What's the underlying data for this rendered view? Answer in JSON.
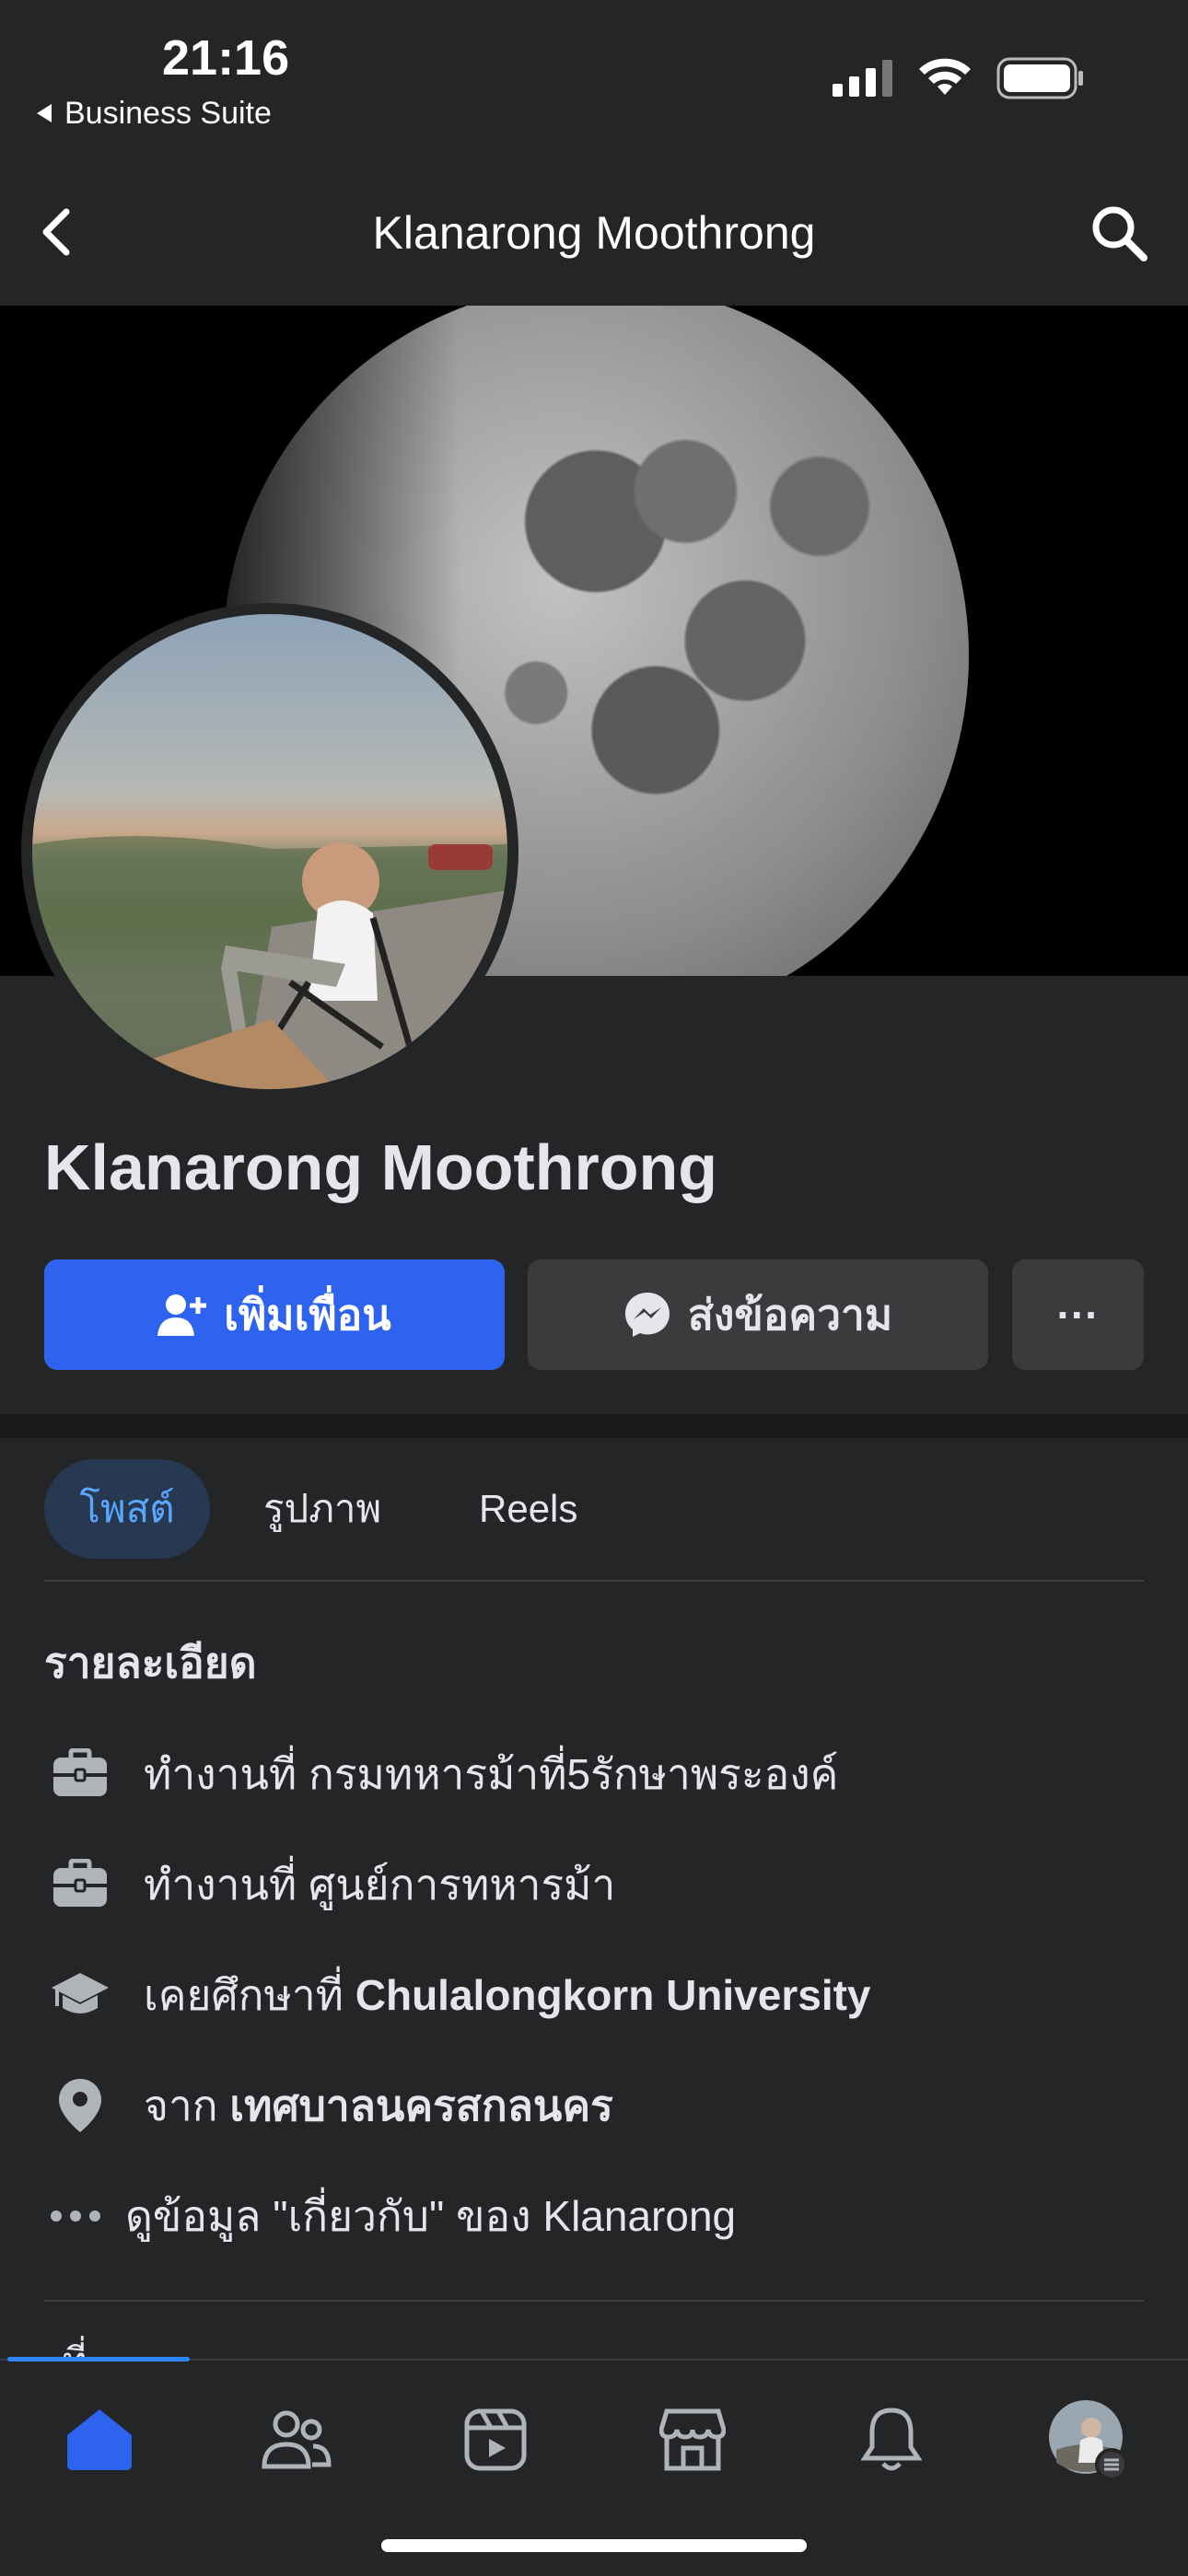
{
  "status": {
    "time": "21:16",
    "back_app": "Business Suite"
  },
  "header": {
    "title": "Klanarong Moothrong"
  },
  "profile": {
    "name": "Klanarong Moothrong"
  },
  "actions": {
    "add_friend": "เพิ่มเพื่อน",
    "message": "ส่งข้อความ",
    "more": "···"
  },
  "tabs": [
    {
      "label": "โพสต์",
      "active": true
    },
    {
      "label": "รูปภาพ"
    },
    {
      "label": "Reels"
    }
  ],
  "details": {
    "title": "รายละเอียด",
    "items": [
      {
        "icon": "briefcase-icon",
        "prefix": "ทำงานที่",
        "value": "กรมทหารม้าที่5รักษาพระองค์"
      },
      {
        "icon": "briefcase-icon",
        "prefix": "ทำงานที่",
        "value": "ศูนย์การทหารม้า"
      },
      {
        "icon": "graduation-cap-icon",
        "prefix": "เคยศึกษาที่",
        "value": "Chulalongkorn University"
      },
      {
        "icon": "location-pin-icon",
        "prefix": "จาก",
        "value": "เทศบาลนครสกลนคร"
      },
      {
        "icon": "more-dots-icon",
        "prefix": "ดูข้อมูล \"เกี่ยวกับ\" ของ Klanarong",
        "value": ""
      }
    ]
  },
  "next_section_peek": "ที่",
  "colors": {
    "primary": "#2d63ee",
    "background": "#242526",
    "surface": "#3a3b3c",
    "accent_tab": "#5aa7ff"
  }
}
